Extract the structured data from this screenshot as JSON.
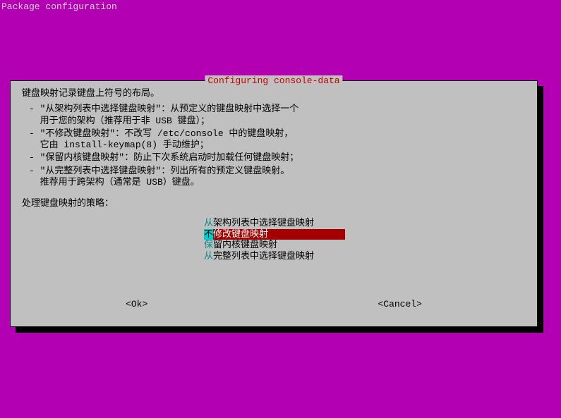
{
  "header": "Package configuration",
  "dialog": {
    "title": "Configuring console-data",
    "intro": "键盘映射记录键盘上符号的布局。",
    "bullets": [
      {
        "l1": "- \"从架构列表中选择键盘映射\"：从预定义的键盘映射中选择一个",
        "l2": "  用于您的架构（推荐用于非 USB 键盘）；"
      },
      {
        "l1": "- \"不修改键盘映射\"：不改写 /etc/console 中的键盘映射，",
        "l2": "  它由 install-keymap(8) 手动维护；"
      },
      {
        "l1": "- \"保留内核键盘映射\"：防止下次系统启动时加载任何键盘映射；",
        "l2": ""
      },
      {
        "l1": "- \"从完整列表中选择键盘映射\"：列出所有的预定义键盘映射。",
        "l2": "  推荐用于跨架构（通常是 USB）键盘。"
      }
    ],
    "prompt": "处理键盘映射的策略：",
    "options": [
      {
        "first": "从",
        "rest": "架构列表中选择键盘映射",
        "selected": false
      },
      {
        "first": "不",
        "rest": "修改键盘映射            ",
        "selected": true
      },
      {
        "first": "保",
        "rest": "留内核键盘映射",
        "selected": false
      },
      {
        "first": "从",
        "rest": "完整列表中选择键盘映射",
        "selected": false
      }
    ],
    "buttons": {
      "ok": "<Ok>",
      "cancel": "<Cancel>"
    }
  }
}
